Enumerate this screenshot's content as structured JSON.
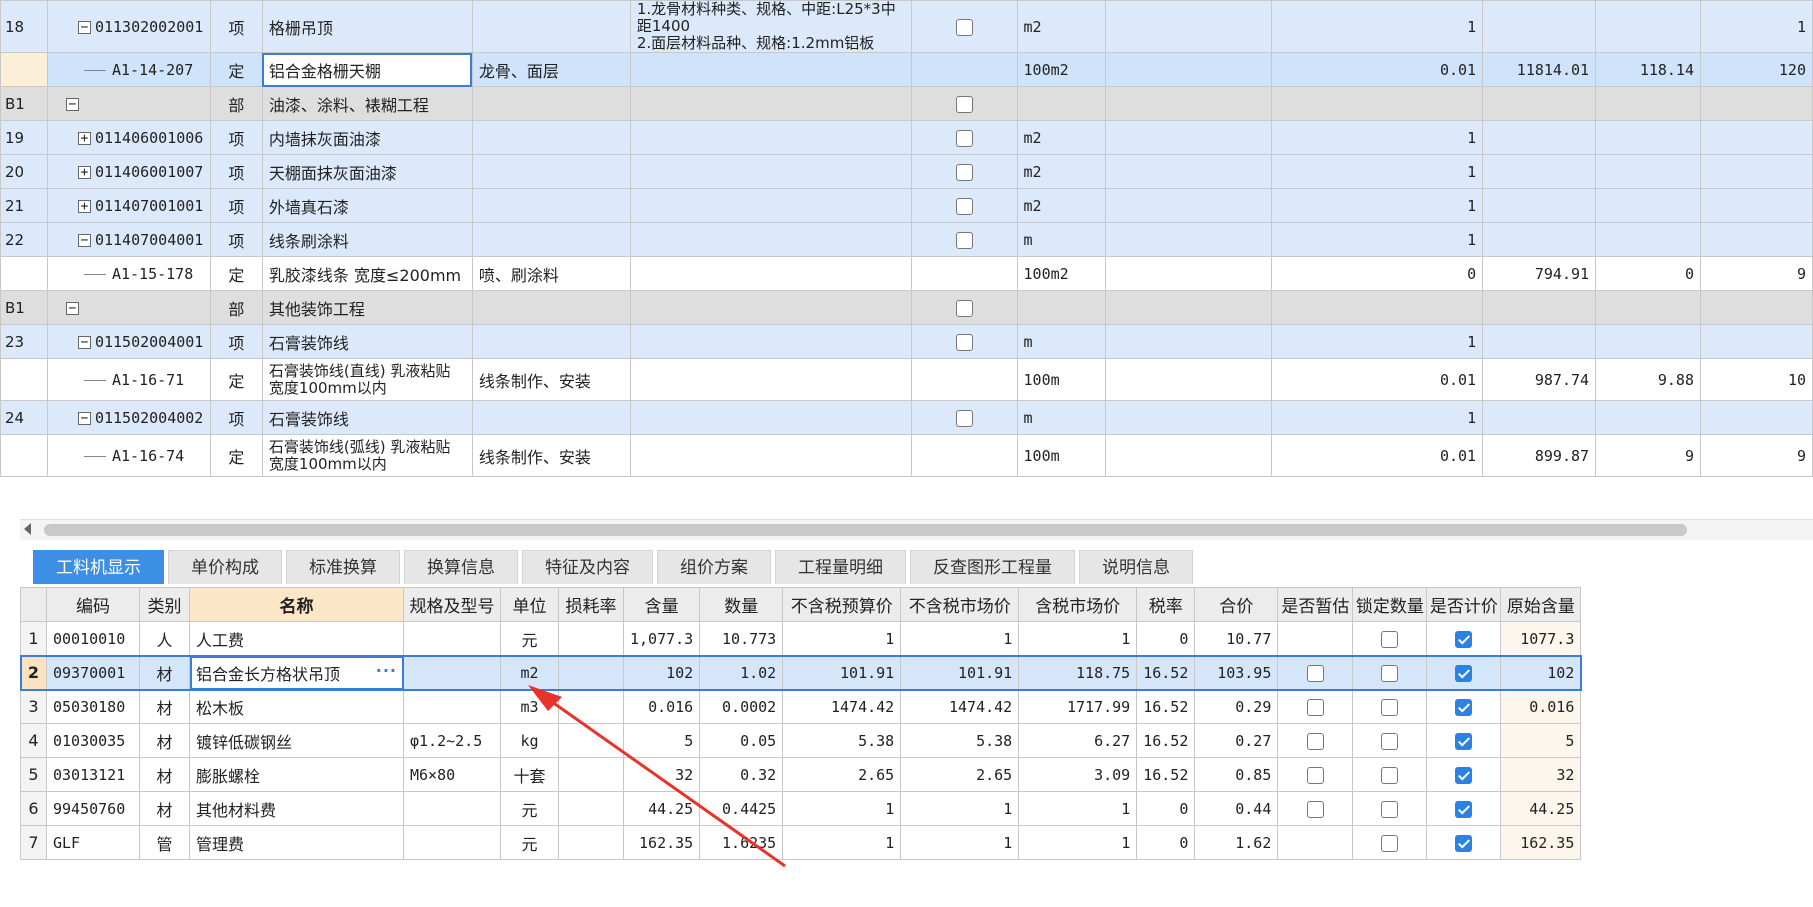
{
  "top_rows": [
    {
      "kind": "item",
      "tall": true,
      "num": "18",
      "toggle": "−",
      "code": "011302002001",
      "type": "项",
      "name": "格栅吊顶",
      "work": "",
      "feature": "1.龙骨材料种类、规格、中距:L25*3中距1400\n2.面层材料品种、规格:1.2mm铝板",
      "checkbox": true,
      "unit": "m2",
      "qty": "1",
      "price": "",
      "total": "",
      "extra": "1"
    },
    {
      "kind": "quota",
      "selected": true,
      "num": "",
      "toggle": "",
      "code": "A1-14-207",
      "type": "定",
      "name": "铝合金格栅天棚",
      "work": "龙骨、面层",
      "feature": "",
      "checkbox": false,
      "unit": "100m2",
      "qty": "0.01",
      "price": "11814.01",
      "total": "118.14",
      "extra": "120"
    },
    {
      "kind": "part",
      "num": "B1",
      "toggle": "−",
      "code": "",
      "type": "部",
      "name": "油漆、涂料、裱糊工程",
      "work": "",
      "feature": "",
      "checkbox": true,
      "unit": "",
      "qty": "",
      "price": "",
      "total": "",
      "extra": ""
    },
    {
      "kind": "item",
      "num": "19",
      "toggle": "+",
      "code": "011406001006",
      "type": "项",
      "name": "内墙抹灰面油漆",
      "work": "",
      "feature": "",
      "checkbox": true,
      "unit": "m2",
      "qty": "1",
      "price": "",
      "total": "",
      "extra": ""
    },
    {
      "kind": "item",
      "num": "20",
      "toggle": "+",
      "code": "011406001007",
      "type": "项",
      "name": "天棚面抹灰面油漆",
      "work": "",
      "feature": "",
      "checkbox": true,
      "unit": "m2",
      "qty": "1",
      "price": "",
      "total": "",
      "extra": ""
    },
    {
      "kind": "item",
      "num": "21",
      "toggle": "+",
      "code": "011407001001",
      "type": "项",
      "name": "外墙真石漆",
      "work": "",
      "feature": "",
      "checkbox": true,
      "unit": "m2",
      "qty": "1",
      "price": "",
      "total": "",
      "extra": ""
    },
    {
      "kind": "item",
      "num": "22",
      "toggle": "−",
      "code": "011407004001",
      "type": "项",
      "name": "线条刷涂料",
      "work": "",
      "feature": "",
      "checkbox": true,
      "unit": "m",
      "qty": "1",
      "price": "",
      "total": "",
      "extra": ""
    },
    {
      "kind": "quota",
      "num": "",
      "toggle": "",
      "code": "A1-15-178",
      "type": "定",
      "name": "乳胶漆线条 宽度≤200mm",
      "work": "喷、刷涂料",
      "feature": "",
      "checkbox": false,
      "unit": "100m2",
      "qty": "0",
      "price": "794.91",
      "total": "0",
      "extra": "9"
    },
    {
      "kind": "part",
      "num": "B1",
      "toggle": "−",
      "code": "",
      "type": "部",
      "name": "其他装饰工程",
      "work": "",
      "feature": "",
      "checkbox": true,
      "unit": "",
      "qty": "",
      "price": "",
      "total": "",
      "extra": ""
    },
    {
      "kind": "item",
      "num": "23",
      "toggle": "−",
      "code": "011502004001",
      "type": "项",
      "name": "石膏装饰线",
      "work": "",
      "feature": "",
      "checkbox": true,
      "unit": "m",
      "qty": "1",
      "price": "",
      "total": "",
      "extra": ""
    },
    {
      "kind": "quota",
      "tall": true,
      "num": "",
      "toggle": "",
      "code": "A1-16-71",
      "type": "定",
      "name": "石膏装饰线(直线) 乳液粘贴\n宽度100mm以内",
      "work": "线条制作、安装",
      "feature": "",
      "checkbox": false,
      "unit": "100m",
      "qty": "0.01",
      "price": "987.74",
      "total": "9.88",
      "extra": "10"
    },
    {
      "kind": "item",
      "num": "24",
      "toggle": "−",
      "code": "011502004002",
      "type": "项",
      "name": "石膏装饰线",
      "work": "",
      "feature": "",
      "checkbox": true,
      "unit": "m",
      "qty": "1",
      "price": "",
      "total": "",
      "extra": ""
    },
    {
      "kind": "quota",
      "tall": true,
      "num": "",
      "toggle": "",
      "code": "A1-16-74",
      "type": "定",
      "name": "石膏装饰线(弧线) 乳液粘贴\n宽度100mm以内",
      "work": "线条制作、安装",
      "feature": "",
      "checkbox": false,
      "unit": "100m",
      "qty": "0.01",
      "price": "899.87",
      "total": "9",
      "extra": "9"
    }
  ],
  "tabs": [
    "工料机显示",
    "单价构成",
    "标准换算",
    "换算信息",
    "特征及内容",
    "组价方案",
    "工程量明细",
    "反查图形工程量",
    "说明信息"
  ],
  "bottom_headers": [
    "",
    "编码",
    "类别",
    "名称",
    "规格及型号",
    "单位",
    "损耗率",
    "含量",
    "数量",
    "不含税预算价",
    "不含税市场价",
    "含税市场价",
    "税率",
    "合价",
    "是否暂估",
    "锁定数量",
    "是否计价",
    "原始含量"
  ],
  "bottom_rows": [
    {
      "n": "1",
      "code": "00010010",
      "cat": "人",
      "name": "人工费",
      "spec": "",
      "unit": "元",
      "loss": "",
      "content": "1,077.3",
      "qty": "10.773",
      "budget": "1",
      "market": "1",
      "taxmarket": "1",
      "tax": "0",
      "total": "10.77",
      "est": null,
      "lock": false,
      "price": true,
      "orig": "1077.3"
    },
    {
      "n": "2",
      "selected": true,
      "code": "09370001",
      "cat": "材",
      "name": "铝合金长方格状吊顶",
      "spec": "",
      "unit": "m2",
      "loss": "",
      "content": "102",
      "qty": "1.02",
      "budget": "101.91",
      "market": "101.91",
      "taxmarket": "118.75",
      "tax": "16.52",
      "total": "103.95",
      "est": false,
      "lock": false,
      "price": true,
      "orig": "102"
    },
    {
      "n": "3",
      "code": "05030180",
      "cat": "材",
      "name": "松木板",
      "spec": "",
      "unit": "m3",
      "loss": "",
      "content": "0.016",
      "qty": "0.0002",
      "budget": "1474.42",
      "market": "1474.42",
      "taxmarket": "1717.99",
      "tax": "16.52",
      "total": "0.29",
      "est": false,
      "lock": false,
      "price": true,
      "orig": "0.016"
    },
    {
      "n": "4",
      "code": "01030035",
      "cat": "材",
      "name": "镀锌低碳钢丝",
      "spec": "φ1.2~2.5",
      "unit": "kg",
      "loss": "",
      "content": "5",
      "qty": "0.05",
      "budget": "5.38",
      "market": "5.38",
      "taxmarket": "6.27",
      "tax": "16.52",
      "total": "0.27",
      "est": false,
      "lock": false,
      "price": true,
      "orig": "5"
    },
    {
      "n": "5",
      "code": "03013121",
      "cat": "材",
      "name": "膨胀螺栓",
      "spec": "M6×80",
      "unit": "十套",
      "loss": "",
      "content": "32",
      "qty": "0.32",
      "budget": "2.65",
      "market": "2.65",
      "taxmarket": "3.09",
      "tax": "16.52",
      "total": "0.85",
      "est": false,
      "lock": false,
      "price": true,
      "orig": "32"
    },
    {
      "n": "6",
      "code": "99450760",
      "cat": "材",
      "name": "其他材料费",
      "spec": "",
      "unit": "元",
      "loss": "",
      "content": "44.25",
      "qty": "0.4425",
      "budget": "1",
      "market": "1",
      "taxmarket": "1",
      "tax": "0",
      "total": "0.44",
      "est": false,
      "lock": false,
      "price": true,
      "orig": "44.25"
    },
    {
      "n": "7",
      "code": "GLF",
      "cat": "管",
      "name": "管理费",
      "spec": "",
      "unit": "元",
      "loss": "",
      "content": "162.35",
      "qty": "1.6235",
      "budget": "1",
      "market": "1",
      "taxmarket": "1",
      "tax": "0",
      "total": "1.62",
      "est": null,
      "lock": false,
      "price": true,
      "orig": "162.35"
    }
  ],
  "ellipsis_label": "···",
  "annotation_color": "#e8332a"
}
